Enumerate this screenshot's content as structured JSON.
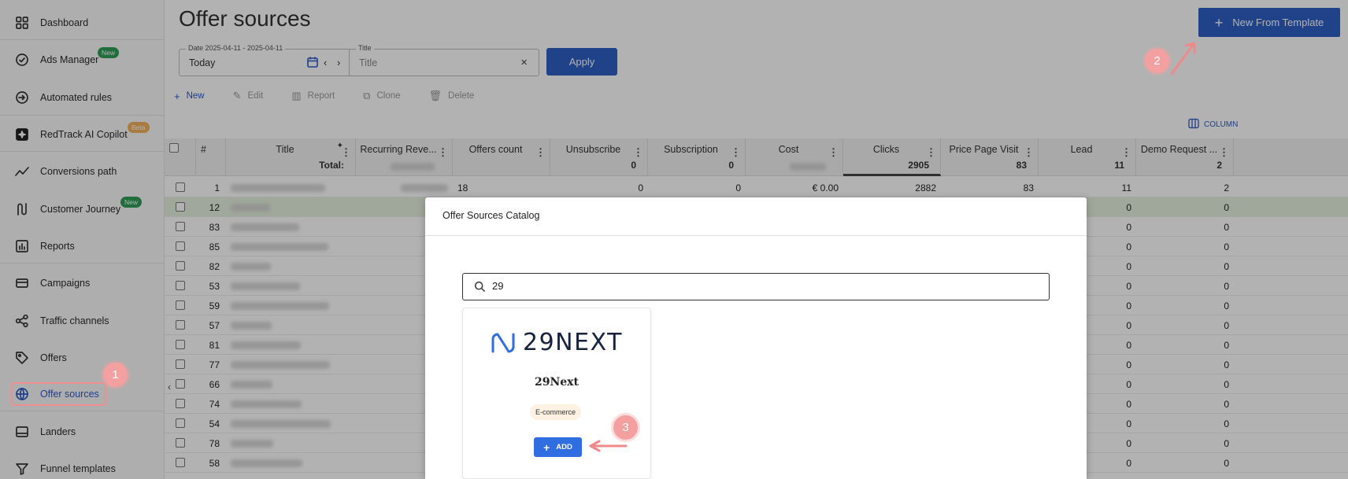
{
  "sidebar": {
    "items": [
      {
        "label": "Dashboard",
        "icon": "dashboard-icon"
      },
      {
        "label": "Ads Manager",
        "icon": "ads-manager-icon",
        "badge": "New"
      },
      {
        "label": "Automated rules",
        "icon": "automated-rules-icon"
      },
      {
        "label": "RedTrack AI Copilot",
        "icon": "ai-copilot-icon",
        "badge": "Beta"
      },
      {
        "label": "Conversions path",
        "icon": "conversions-path-icon"
      },
      {
        "label": "Customer Journey",
        "icon": "customer-journey-icon",
        "badge": "New"
      },
      {
        "label": "Reports",
        "icon": "reports-icon"
      },
      {
        "label": "Campaigns",
        "icon": "campaigns-icon"
      },
      {
        "label": "Traffic channels",
        "icon": "traffic-channels-icon"
      },
      {
        "label": "Offers",
        "icon": "offers-icon"
      },
      {
        "label": "Offer sources",
        "icon": "globe-icon",
        "active": true
      },
      {
        "label": "Landers",
        "icon": "landers-icon"
      },
      {
        "label": "Funnel templates",
        "icon": "funnel-icon"
      }
    ],
    "collapse": "‹"
  },
  "header": {
    "title": "Offer sources",
    "template_button": "New From Template"
  },
  "filters": {
    "date_label": "Date 2025-04-11 - 2025-04-11",
    "date_value": "Today",
    "title_label": "Title",
    "title_placeholder": "Title",
    "apply": "Apply"
  },
  "toolbar": {
    "new": "New",
    "edit": "Edit",
    "report": "Report",
    "clone": "Clone",
    "delete": "Delete",
    "columns": "COLUMN"
  },
  "table": {
    "headers": [
      {
        "label": "#"
      },
      {
        "label": "Title",
        "total": "Total:"
      },
      {
        "label": "Recurring Reve..."
      },
      {
        "label": "Offers count"
      },
      {
        "label": "Unsubscribe",
        "total": "0"
      },
      {
        "label": "Subscription",
        "total": "0"
      },
      {
        "label": "Cost"
      },
      {
        "label": "Clicks",
        "total": "2905"
      },
      {
        "label": "Price Page Visit",
        "total": "83"
      },
      {
        "label": "Lead",
        "total": "11"
      },
      {
        "label": "Demo Request ...",
        "total": "2"
      }
    ],
    "first_row": {
      "id": "1",
      "offers": "18",
      "unsubscribe": "0",
      "subscription": "0",
      "cost": "€ 0.00",
      "clicks": "2882",
      "ppv": "83",
      "lead": "11",
      "demo": "2"
    },
    "row_ids": [
      "12",
      "83",
      "85",
      "82",
      "53",
      "59",
      "57",
      "81",
      "77",
      "66",
      "74",
      "54",
      "78",
      "58"
    ],
    "zero": "0"
  },
  "modal": {
    "title": "Offer Sources Catalog",
    "search_value": "29",
    "card": {
      "logo_text": "29NEXT",
      "name": "29Next",
      "tag": "E-commerce",
      "add": "ADD"
    }
  },
  "annotations": {
    "m1": "1",
    "m2": "2",
    "m3": "3",
    "color": "#f4a0a0"
  }
}
